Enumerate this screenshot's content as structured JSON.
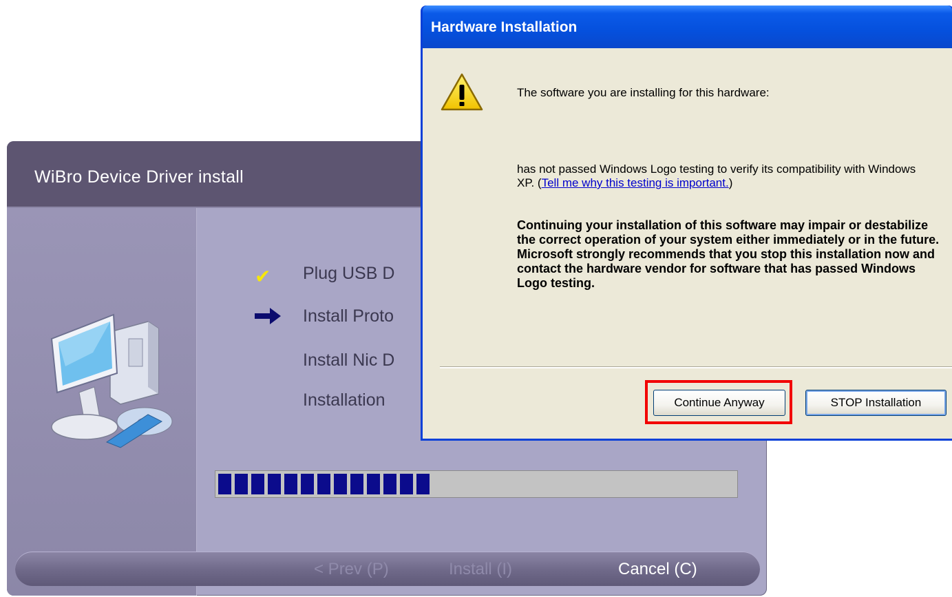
{
  "installer": {
    "title": "WiBro Device Driver install",
    "steps": [
      {
        "label": "Plug USB D",
        "status": "done"
      },
      {
        "label": "Install Proto",
        "status": "current"
      },
      {
        "label": "Install Nic D",
        "status": "pending"
      },
      {
        "label": "Installation",
        "status": "pending"
      }
    ],
    "progress_percent": 41,
    "buttons": {
      "prev": "< Prev (P)",
      "install": "Install (I)",
      "cancel": "Cancel (C)"
    }
  },
  "dialog": {
    "title": "Hardware Installation",
    "line1": "The software you are installing for this hardware:",
    "line2_prefix": "has not passed Windows Logo testing to verify its compatibility with Windows XP. (",
    "line2_link": "Tell me why this testing is important.",
    "line2_suffix": ")",
    "warning": "Continuing your installation of this software may impair or destabilize the correct operation of your system either immediately or in the future. Microsoft strongly recommends that you stop this installation now and contact the hardware vendor for software that has passed Windows Logo testing.",
    "buttons": {
      "continue": "Continue Anyway",
      "stop": "STOP Installation"
    }
  },
  "icons": {
    "check": "check-icon",
    "arrow": "arrow-right-icon",
    "warning": "warning-icon",
    "computer": "computer-icon"
  },
  "colors": {
    "highlight": "#f20000",
    "progress": "#0b0b8c",
    "check": "#f6e70b"
  }
}
